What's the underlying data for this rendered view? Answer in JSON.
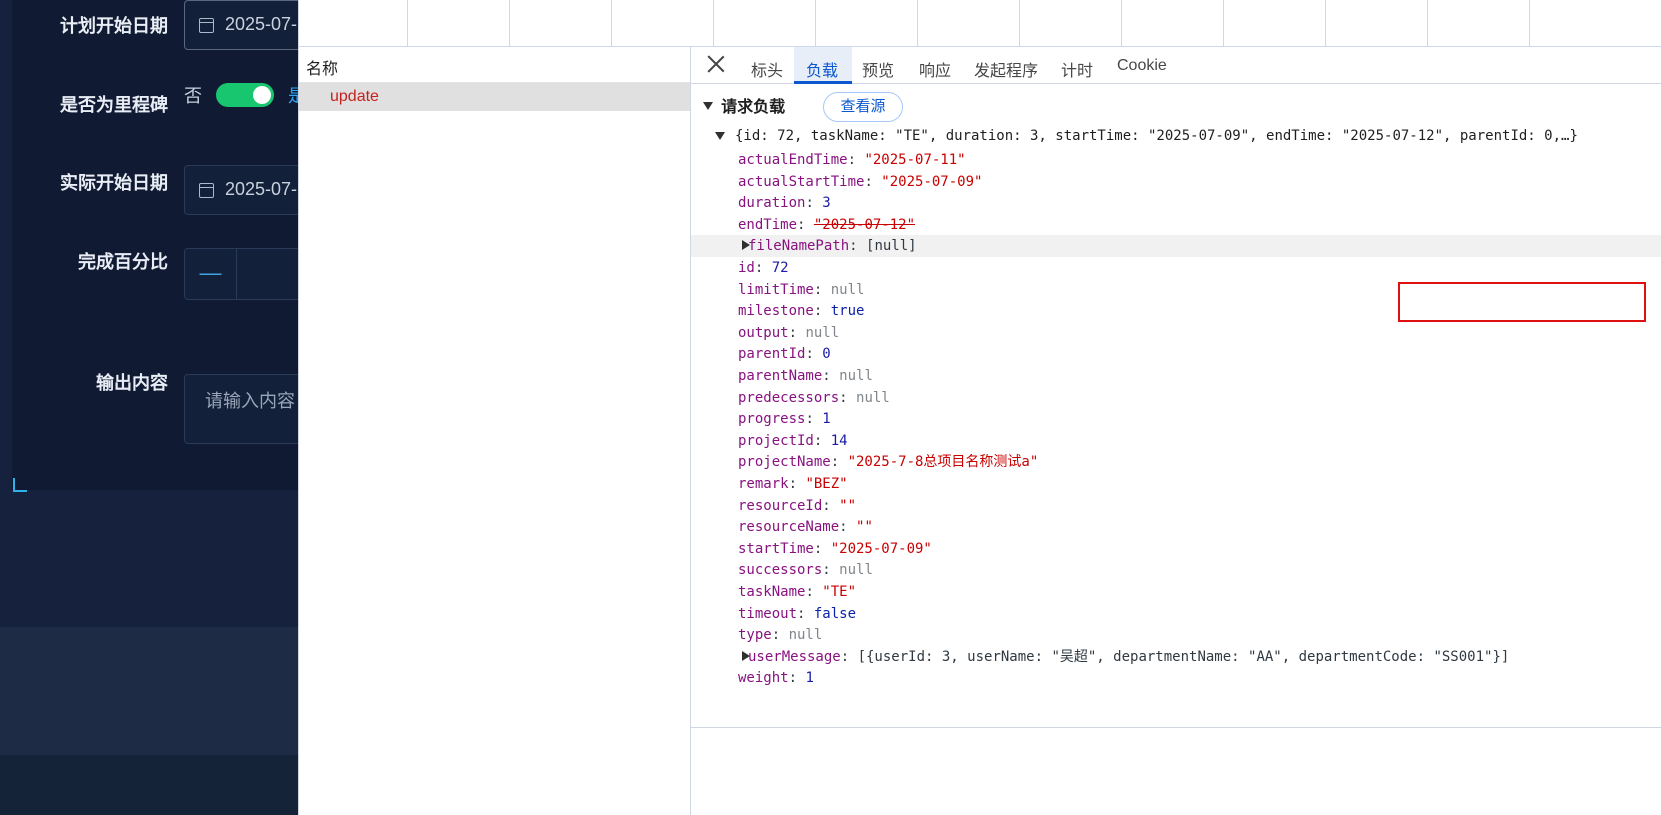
{
  "form": {
    "plan_start_label": "计划开始日期",
    "plan_start_value": "2025-07-",
    "milestone_label": "是否为里程碑",
    "milestone_off_text": "否",
    "milestone_on_text": "是",
    "actual_start_label": "实际开始日期",
    "actual_start_value": "2025-07-",
    "progress_label": "完成百分比",
    "progress_minus": "—",
    "output_label": "输出内容",
    "output_placeholder": "请输入内容"
  },
  "devtools": {
    "name_header": "名称",
    "request_name": "update",
    "tabs": [
      "标头",
      "负载",
      "预览",
      "响应",
      "发起程序",
      "计时",
      "Cookie"
    ],
    "active_tab": "负载",
    "payload_title": "请求负载",
    "view_source": "查看源",
    "summary": "{id: 72, taskName: \"TE\", duration: 3, startTime: \"2025-07-09\", endTime: \"2025-07-12\", parentId: 0,…}",
    "properties": [
      {
        "key": "actualEndTime",
        "value": "\"2025-07-11\"",
        "type": "str"
      },
      {
        "key": "actualStartTime",
        "value": "\"2025-07-09\"",
        "type": "str"
      },
      {
        "key": "duration",
        "value": "3",
        "type": "num"
      },
      {
        "key": "endTime",
        "value": "\"2025-07-12\"",
        "type": "str"
      },
      {
        "key": "fileNamePath",
        "value": "[null]",
        "type": "plain",
        "expandable": true
      },
      {
        "key": "id",
        "value": "72",
        "type": "num"
      },
      {
        "key": "limitTime",
        "value": "null",
        "type": "null"
      },
      {
        "key": "milestone",
        "value": "true",
        "type": "bool"
      },
      {
        "key": "output",
        "value": "null",
        "type": "null"
      },
      {
        "key": "parentId",
        "value": "0",
        "type": "num"
      },
      {
        "key": "parentName",
        "value": "null",
        "type": "null"
      },
      {
        "key": "predecessors",
        "value": "null",
        "type": "null"
      },
      {
        "key": "progress",
        "value": "1",
        "type": "num"
      },
      {
        "key": "projectId",
        "value": "14",
        "type": "num"
      },
      {
        "key": "projectName",
        "value": "\"2025-7-8总项目名称测试a\"",
        "type": "str"
      },
      {
        "key": "remark",
        "value": "\"BEZ\"",
        "type": "str"
      },
      {
        "key": "resourceId",
        "value": "\"\"",
        "type": "str"
      },
      {
        "key": "resourceName",
        "value": "\"\"",
        "type": "str"
      },
      {
        "key": "startTime",
        "value": "\"2025-07-09\"",
        "type": "str"
      },
      {
        "key": "successors",
        "value": "null",
        "type": "null"
      },
      {
        "key": "taskName",
        "value": "\"TE\"",
        "type": "str"
      },
      {
        "key": "timeout",
        "value": "false",
        "type": "bool"
      },
      {
        "key": "type",
        "value": "null",
        "type": "null"
      },
      {
        "key": "userMessage",
        "value": "[{userId: 3, userName: \"吴超\", departmentName: \"AA\", departmentCode: \"SS001\"}]",
        "type": "plain",
        "expandable": true
      },
      {
        "key": "weight",
        "value": "1",
        "type": "num"
      }
    ]
  },
  "colors": {
    "highlight_box": "#e01010",
    "active_tab": "#0b57d0",
    "toggle_on": "#18c66f"
  }
}
